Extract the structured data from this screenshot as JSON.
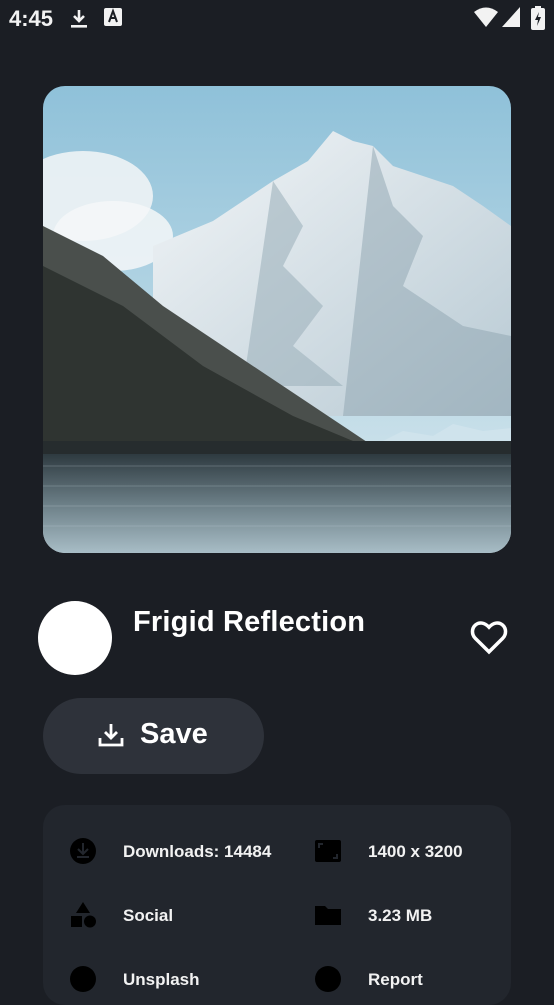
{
  "status_bar": {
    "time": "4:45",
    "icons": [
      "download-icon",
      "text-a-icon",
      "wifi-icon",
      "signal-icon",
      "battery-icon"
    ]
  },
  "wallpaper": {
    "description_icon": "mountain-lake-photo"
  },
  "details": {
    "title": "Frigid Reflection",
    "favorite_icon": "heart-outline-icon"
  },
  "actions": {
    "save_label": "Save",
    "save_icon": "download-icon"
  },
  "info": {
    "downloads": "Downloads: 14484",
    "resolution": "1400 x 3200",
    "category": "Social",
    "size": "3.23 MB",
    "source": "Unsplash",
    "report": "Report"
  },
  "colors": {
    "background": "#1b1e24",
    "button": "#2e323a",
    "card": "#22262d",
    "icon": "#000000"
  }
}
